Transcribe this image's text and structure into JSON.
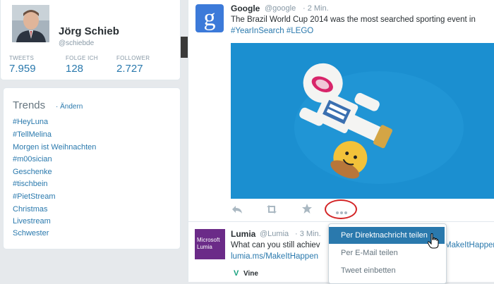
{
  "profile": {
    "name": "Jörg Schieb",
    "handle": "@schiebde",
    "stats": [
      {
        "label": "TWEETS",
        "value": "7.959"
      },
      {
        "label": "FOLGE ICH",
        "value": "128"
      },
      {
        "label": "FOLLOWER",
        "value": "2.727"
      }
    ]
  },
  "trends": {
    "title": "Trends",
    "change": "· Ändern",
    "items": [
      "#HeyLuna",
      "#TellMelina",
      "Morgen ist Weihnachten",
      "#m00sician",
      "Geschenke",
      "#tischbein",
      "#PietStream",
      "Christmas",
      "Livestream",
      "Schwester"
    ]
  },
  "tweet1": {
    "name": "Google",
    "handle": "@google",
    "time": "· 2 Min.",
    "text": "The Brazil World Cup 2014 was the most searched sporting event in",
    "tags": "#YearInSearch #LEGO",
    "logo": "g"
  },
  "tweet2": {
    "name": "Lumia",
    "handle": "@Lumia",
    "time": "· 3 Min.",
    "text": "What can you still achiev",
    "text_right": "MakeItHappen",
    "link": "lumia.ms/MakeItHappen",
    "logo_line1": "Microsoft",
    "logo_line2": "Lumia",
    "vine": "Vine"
  },
  "menu": {
    "items": [
      "Per Direktnachricht teilen",
      "Per E-Mail teilen",
      "Tweet einbetten"
    ]
  },
  "icons": {
    "reply": "reply-icon",
    "retweet": "retweet-icon",
    "favorite": "star-icon",
    "more": "more-dots-icon"
  },
  "colors": {
    "link": "#2a79ad",
    "highlight": "#2a79ad",
    "annotation": "#d32325",
    "media_bg": "#1b8fd0"
  }
}
